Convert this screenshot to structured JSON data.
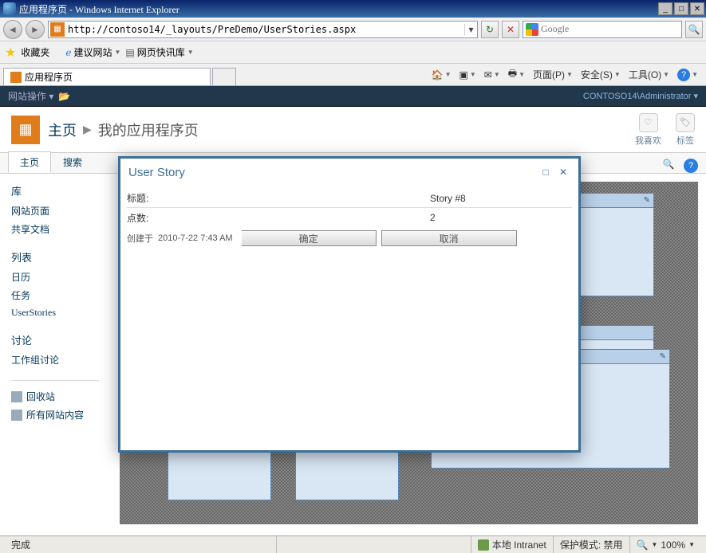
{
  "window": {
    "title": "应用程序页 - Windows Internet Explorer"
  },
  "nav": {
    "url": "http://contoso14/_layouts/PreDemo/UserStories.aspx",
    "search_placeholder": "Google"
  },
  "favorites": {
    "label": "收藏夹",
    "suggested": "建议网站",
    "slice": "网页快讯库"
  },
  "tab": {
    "title": "应用程序页"
  },
  "cmdbar": {
    "page": "页面(P)",
    "safety": "安全(S)",
    "tools": "工具(O)"
  },
  "sp": {
    "site_actions": "网站操作",
    "user": "CONTOSO14\\Administrator",
    "home": "主页",
    "breadcrumb_current": "我的应用程序页",
    "like": "我喜欢",
    "tags": "标签",
    "tab_home": "主页",
    "tab_search": "搜索"
  },
  "leftnav": {
    "libraries": "库",
    "site_pages": "网站页面",
    "shared_docs": "共享文档",
    "lists": "列表",
    "calendar": "日历",
    "tasks": "任务",
    "userstories": "UserStories",
    "discussions": "讨论",
    "team_discussion": "工作组讨论",
    "recycle": "回收站",
    "all_content": "所有网站内容"
  },
  "dialog": {
    "title": "User Story",
    "field_title_label": "标题:",
    "field_title_value": "Story #8",
    "field_points_label": "点数:",
    "field_points_value": "2",
    "created_prefix": "创建于",
    "created_value": "2010-7-22 7:43 AM",
    "ok": "确定",
    "cancel": "取消"
  },
  "status": {
    "done": "完成",
    "zone": "本地 Intranet",
    "protected": "保护模式: 禁用",
    "zoom": "100%"
  }
}
